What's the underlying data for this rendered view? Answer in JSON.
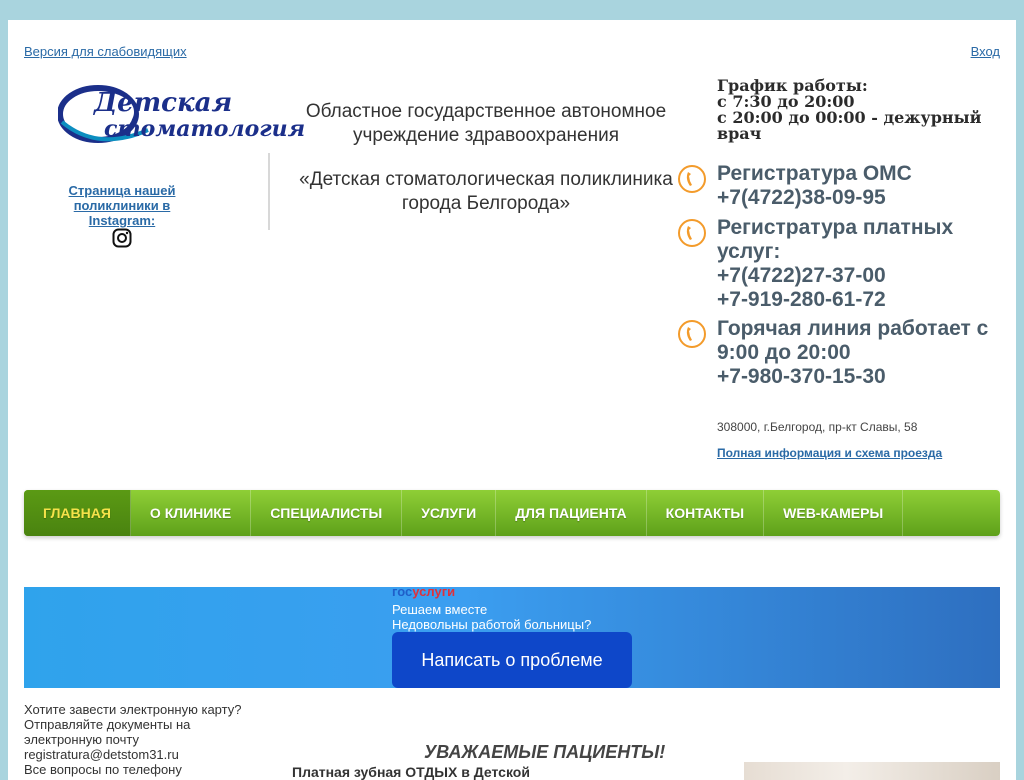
{
  "header": {
    "accessibility_link": "Версия для слабовидящих",
    "login_link": "Вход"
  },
  "logo": {
    "line1": "Детская",
    "line2": "стоматология"
  },
  "instagram": {
    "label": "Страница нашей поликлиники в Instagram:",
    "icon": "instagram-icon"
  },
  "organization": {
    "line1": "Областное государственное автономное",
    "line2": "учреждение здравоохранения",
    "line3": "«Детская стоматологическая поликлиника",
    "line4": "города Белгорода»"
  },
  "schedule": {
    "title": "График работы:",
    "line1": "с 7:30 до 20:00",
    "line2": "с 20:00 до 00:00 - дежурный врач"
  },
  "phones": [
    {
      "icon": "phone-icon",
      "label": "Регистратура ОМС",
      "numbers": [
        "+7(4722)38-09-95"
      ]
    },
    {
      "icon": "phone-icon",
      "label": "Регистратура платных услуг:",
      "numbers": [
        "+7(4722)27-37-00",
        "+7-919-280-61-72"
      ]
    },
    {
      "icon": "phone-icon",
      "label": "Горячая линия работает с 9:00 до 20:00",
      "numbers": [
        "+7-980-370-15-30"
      ]
    }
  ],
  "address": {
    "text": "308000, г.Белгород, пр-кт Славы, 58",
    "link": "Полная информация и схема проезда"
  },
  "nav": {
    "items": [
      "ГЛАВНАЯ",
      "О КЛИНИКЕ",
      "СПЕЦИАЛИСТЫ",
      "УСЛУГИ",
      "ДЛЯ ПАЦИЕНТА",
      "КОНТАКТЫ",
      "WEB-КАМЕРЫ"
    ],
    "active_index": 0
  },
  "gosuslugi": {
    "logo_part1": "гос",
    "logo_part2": "услуги",
    "line1": "Решаем вместе",
    "line2": "Недовольны работой больницы?",
    "button": "Написать о проблеме"
  },
  "left_column": {
    "line1": "Хотите завести электронную карту?",
    "line2": "Отправляйте документы  на",
    "line3": "электронную почту",
    "line4": "registratura@detstom31.ru",
    "line5": "Все вопросы по телефону"
  },
  "main": {
    "heading": "УВАЖАЕМЫЕ ПАЦИЕНТЫ!",
    "text_fragment": "Платная зубная ОТДЫХ в Детской"
  },
  "colors": {
    "nav_green": "#6db024",
    "active_nav_text": "#f5e24a",
    "banner_blue": "#2fa3ec",
    "button_blue": "#0e47c9",
    "link_blue": "#2a6aa6",
    "phone_orange": "#f39b2b"
  }
}
